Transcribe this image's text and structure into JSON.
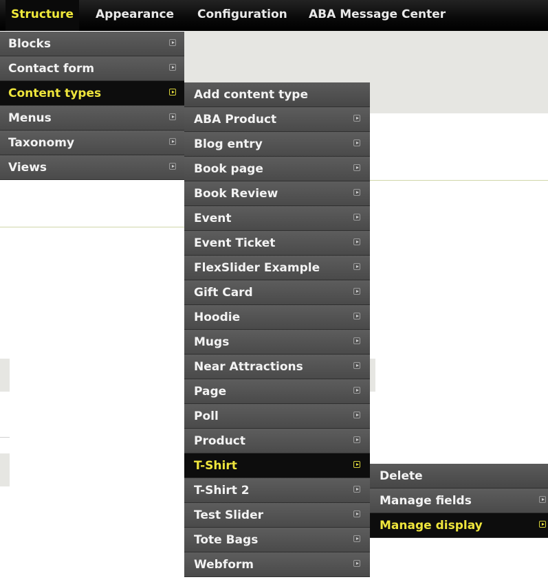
{
  "topbar": {
    "items": [
      {
        "label": "Structure"
      },
      {
        "label": "Appearance"
      },
      {
        "label": "Configuration"
      },
      {
        "label": "ABA Message Center"
      }
    ]
  },
  "structure_menu": {
    "items": [
      {
        "label": "Blocks"
      },
      {
        "label": "Contact form"
      },
      {
        "label": "Content types"
      },
      {
        "label": "Menus"
      },
      {
        "label": "Taxonomy"
      },
      {
        "label": "Views"
      }
    ]
  },
  "content_types_menu": {
    "items": [
      {
        "label": "Add content type"
      },
      {
        "label": "ABA Product"
      },
      {
        "label": "Blog entry"
      },
      {
        "label": "Book page"
      },
      {
        "label": "Book Review"
      },
      {
        "label": "Event"
      },
      {
        "label": "Event Ticket"
      },
      {
        "label": "FlexSlider Example"
      },
      {
        "label": "Gift Card"
      },
      {
        "label": "Hoodie"
      },
      {
        "label": "Mugs"
      },
      {
        "label": "Near Attractions"
      },
      {
        "label": "Page"
      },
      {
        "label": "Poll"
      },
      {
        "label": "Product"
      },
      {
        "label": "T-Shirt"
      },
      {
        "label": "T-Shirt 2"
      },
      {
        "label": "Test Slider"
      },
      {
        "label": "Tote Bags"
      },
      {
        "label": "Webform"
      }
    ]
  },
  "tshirt_menu": {
    "items": [
      {
        "label": "Delete"
      },
      {
        "label": "Manage fields"
      },
      {
        "label": "Manage display"
      }
    ]
  },
  "colors": {
    "active_text": "#eee53c",
    "menu_bg": "#545454",
    "active_bg": "#0d0d0d"
  }
}
